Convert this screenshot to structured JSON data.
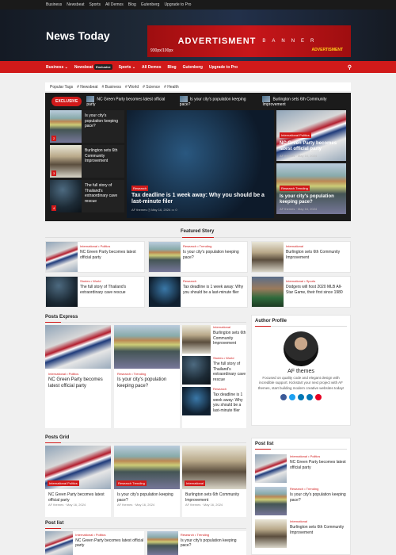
{
  "topbar": [
    "Business",
    "Newsbeat",
    "Sports",
    "All Demos",
    "Blog",
    "Gutenberg",
    "Upgrade to Pro"
  ],
  "site_title": "News Today",
  "ad": {
    "title": "ADVERTISMENT",
    "banner": "BANNER",
    "size": "930px/100px",
    "right": "ADVERTISMENT"
  },
  "nav": {
    "items": [
      "Business ⌄",
      "Newsbeat",
      "Sports ⌄",
      "All Demos",
      "Blog",
      "Gutenberg",
      "Upgrade to Pro"
    ],
    "badge": "Exclusive"
  },
  "tags": {
    "label": "Popular Tags",
    "items": [
      "# Newsbeat",
      "# Business",
      "# World",
      "# Science",
      "# Health"
    ]
  },
  "trending": {
    "label": "EXCLUSIVE",
    "items": [
      "NC Green Party becomes latest official party",
      "Is your city's population keeping pace?",
      "Burlington sets 6th Community Improvement"
    ]
  },
  "slider_left": [
    {
      "title": "Is your city's population keeping pace?",
      "num": "2"
    },
    {
      "title": "Burlington sets 6th Community Improvement",
      "num": "3"
    },
    {
      "title": "The full story of Thailand's extraordinary cave rescue",
      "num": "4"
    }
  ],
  "slider_main": {
    "cat": "Research",
    "title": "Tax deadline is 1 week away: Why you should be a last-minute filer",
    "author": "AF themes",
    "date": "May 16, 2024",
    "comments": "0"
  },
  "slider_right": [
    {
      "cats": "International  Politics",
      "title": "NC Green Party becomes latest official party",
      "author": "AF themes",
      "date": "May 16, 2024"
    },
    {
      "cats": "Research  Trending",
      "title": "Is your city's population keeping pace?",
      "author": "AF themes",
      "date": "May 16, 2024"
    }
  ],
  "featured": {
    "title": "Featured Story",
    "items": [
      {
        "cat": "International  •  Politics",
        "title": "NC Green Party becomes latest official party"
      },
      {
        "cat": "Research  •  Trending",
        "title": "Is your city's population keeping pace?"
      },
      {
        "cat": "International",
        "title": "Burlington sets 6th Community Improvement"
      },
      {
        "cat": "Stories  •  World",
        "title": "The full story of Thailand's extraordinary cave rescue"
      },
      {
        "cat": "Research",
        "title": "Tax deadline is 1 week away: Why you should be a last-minute filer"
      },
      {
        "cat": "International  •  Sports",
        "title": "Dodgers will host 2020 MLB All-Star Game, their first since 1980"
      }
    ]
  },
  "express": {
    "title": "Posts Express",
    "cards": [
      {
        "cat": "International  •  Politics",
        "title": "NC Green Party becomes latest official party"
      },
      {
        "cat": "Research  •  Trending",
        "title": "Is your city's population keeping pace?"
      }
    ],
    "minis": [
      {
        "cat": "International",
        "title": "Burlington sets 6th Community Improvement"
      },
      {
        "cat": "Stories  •  World",
        "title": "The full story of Thailand's extraordinary cave rescue"
      },
      {
        "cat": "Research",
        "title": "Tax deadline is 1 week away: Why you should be a last-minute filer"
      }
    ]
  },
  "author": {
    "title": "Author Profile",
    "name": "AF themes",
    "bio": "Focused on quality code and elegant design with incredible support. Kickstart your next project with AF themes, start building modern creative websites today!"
  },
  "grid": {
    "title": "Posts Grid",
    "cards": [
      {
        "cats": "International  Politics",
        "title": "NC Green Party becomes latest official party",
        "author": "AF themes",
        "date": "May 16, 2024"
      },
      {
        "cats": "Research  Trending",
        "title": "Is your city's population keeping pace?",
        "author": "AF themes",
        "date": "May 16, 2024"
      },
      {
        "cats": "International",
        "title": "Burlington sets 6th Community Improvement",
        "author": "AF themes",
        "date": "May 16, 2024"
      }
    ]
  },
  "postlist_bottom": {
    "title": "Post list",
    "items": [
      {
        "cat": "International  •  Politics",
        "title": "NC Green Party becomes latest official party"
      },
      {
        "cat": "Research  •  Trending",
        "title": "Is your city's population keeping pace?"
      }
    ]
  },
  "postlist_side": {
    "title": "Post list",
    "items": [
      {
        "cat": "International  •  Politics",
        "title": "NC Green Party becomes latest official party"
      },
      {
        "cat": "Research  •  Trending",
        "title": "Is your city's population keeping pace?"
      },
      {
        "cat": "International",
        "title": "Burlington sets 6th Community Improvement"
      }
    ]
  }
}
